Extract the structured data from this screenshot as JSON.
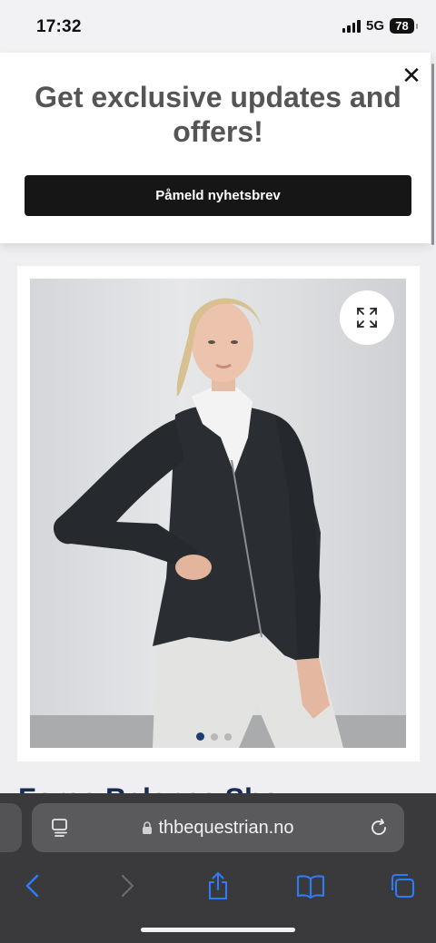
{
  "status_bar": {
    "time": "17:32",
    "network": "5G",
    "battery": "78"
  },
  "promo": {
    "title": "Get exclusive updates and offers!",
    "button_label": "Påmeld nyhetsbrev",
    "close_icon": "close-icon"
  },
  "product": {
    "image_alt": "Woman in black zip riding jacket and white breeches",
    "zoom_icon": "expand-icon",
    "carousel": {
      "count": 3,
      "active": 1
    },
    "title_peek": "Force Balance Show"
  },
  "browser": {
    "url": "thbequestrian.no",
    "colors": {
      "toolbar": "#3a3a3c",
      "accent": "#2f7bf6"
    }
  }
}
